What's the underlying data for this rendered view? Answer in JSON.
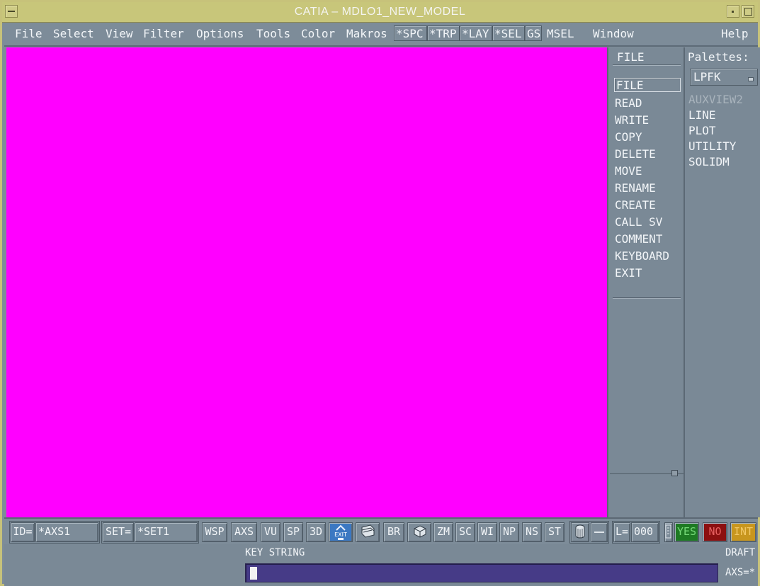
{
  "window": {
    "title": "CATIA – MDLO1_NEW_MODEL"
  },
  "menubar": {
    "items": [
      "File",
      "Select",
      "View",
      "Filter",
      "Options",
      "Tools",
      "Color",
      "Makros"
    ],
    "toggles": [
      "*SPC",
      "*TRP",
      "*LAY",
      "*SEL",
      "GS"
    ],
    "msel": "MSEL",
    "window": "Window",
    "help": "Help"
  },
  "function_panel": {
    "header": "FILE",
    "items": [
      "FILE",
      "READ",
      "WRITE",
      "COPY",
      "DELETE",
      "MOVE",
      "RENAME",
      "CREATE",
      "CALL SV",
      "COMMENT",
      "KEYBOARD",
      "EXIT"
    ],
    "selected": "FILE"
  },
  "palette_panel": {
    "header": "Palettes:",
    "dropdown_value": "LPFK",
    "items": [
      "AUXVIEW2",
      "LINE",
      "PLOT",
      "UTILITY",
      "SOLIDM"
    ],
    "disabled": "AUXVIEW2"
  },
  "bottombar": {
    "id_label": "ID=",
    "id_value": "*AXS1",
    "set_label": "SET=",
    "set_value": "*SET1",
    "buttons": [
      "WSP",
      "AXS",
      "VU",
      "SP",
      "3D",
      "EXIT",
      "BR",
      "ZM",
      "SC",
      "WI",
      "NP",
      "NS",
      "ST"
    ],
    "l_label": "L=",
    "l_value": "000",
    "yes": "YES",
    "no": "NO",
    "int": "INT"
  },
  "status": {
    "key_string_label": "KEY STRING",
    "mode": "DRAFT",
    "axs": "AXS=*"
  },
  "colors": {
    "canvas": "#ff00ff",
    "frame": "#7d8c99",
    "titlebar": "#c8c67a",
    "input": "#463b87"
  }
}
